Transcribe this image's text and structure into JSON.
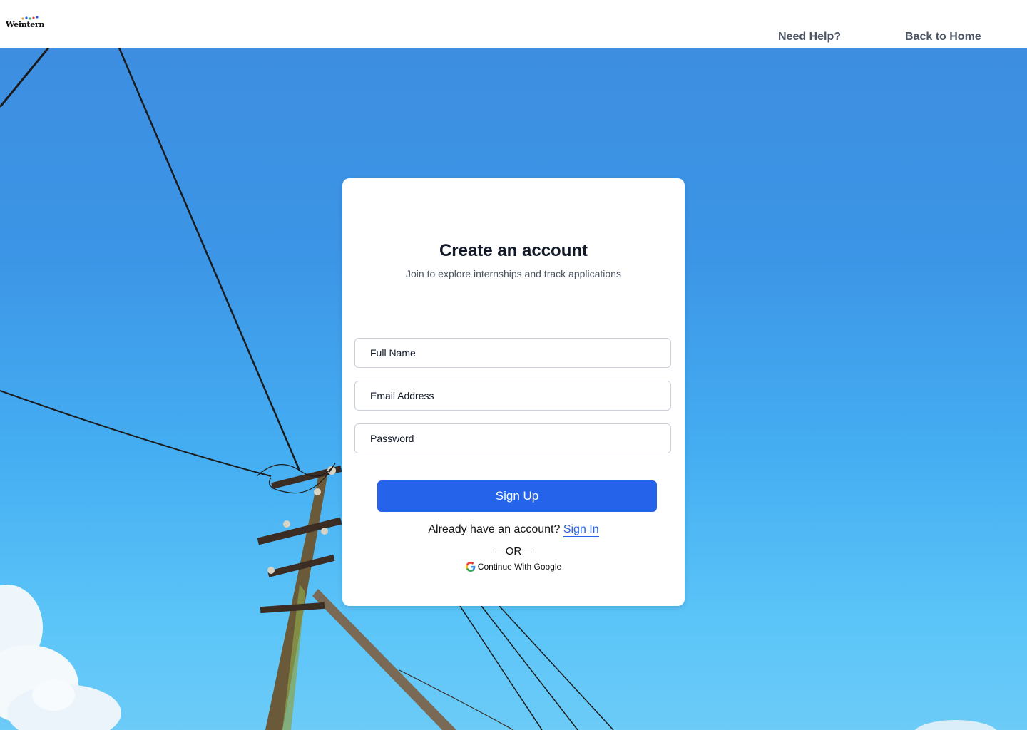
{
  "header": {
    "logo_text": "Weintern",
    "nav": {
      "help_label": "Need Help?",
      "home_label": "Back to Home"
    }
  },
  "signup": {
    "title": "Create an account",
    "subtitle": "Join to explore internships and track applications",
    "fields": {
      "full_name_placeholder": "Full Name",
      "email_placeholder": "Email Address",
      "password_placeholder": "Password"
    },
    "submit_label": "Sign Up",
    "signin_prompt": "Already have an account?",
    "signin_link": "Sign In",
    "divider_label": "OR",
    "google_label": "Continue With Google"
  },
  "colors": {
    "accent": "#2563eb",
    "nav_text": "#4b5563",
    "sky": "#3c95e6"
  },
  "icons": {
    "google": "google-icon"
  }
}
